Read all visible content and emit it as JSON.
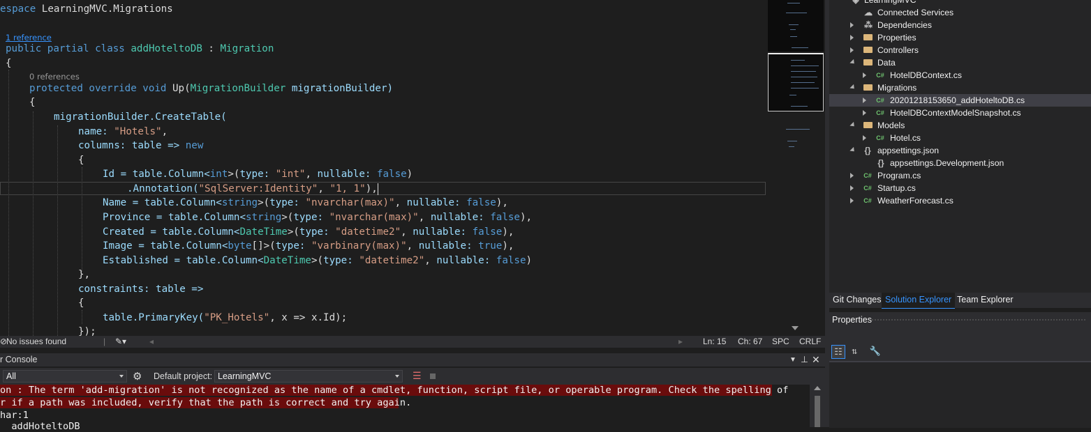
{
  "editor": {
    "codelens": {
      "class_refs": "1 reference",
      "method_refs": "0 references"
    },
    "lines": {
      "l0_pre": "espace ",
      "l0_ns": "LearningMVC.Migrations",
      "l1_kw": "public partial class ",
      "l1_name": "addHoteltoDB",
      "l1_sep": " : ",
      "l1_base": "Migration",
      "l2": "{",
      "l3_kw": "protected override void ",
      "l3_name": "Up(",
      "l3_type": "MigrationBuilder",
      "l3_param": " migrationBuilder)",
      "l4": "{",
      "l5": "migrationBuilder.CreateTable(",
      "l6_a": "name: ",
      "l6_b": "\"Hotels\"",
      "l6_c": ",",
      "l7_a": "columns: ",
      "l7_b": "table => ",
      "l7_c": "new",
      "l8": "{",
      "l9_a": "Id = table.Column<",
      "l9_b": "int",
      "l9_c": ">(",
      "l9_d": "type: ",
      "l9_e": "\"int\"",
      "l9_f": ", ",
      "l9_g": "nullable: ",
      "l9_h": "false",
      "l9_i": ")",
      "l10_a": ".Annotation(",
      "l10_b": "\"SqlServer:Identity\"",
      "l10_c": ", ",
      "l10_d": "\"1, 1\"",
      "l10_e": "),",
      "l11_a": "Name = table.Column<",
      "l11_b": "string",
      "l11_c": ">(",
      "l11_d": "type: ",
      "l11_e": "\"nvarchar(max)\"",
      "l11_f": ", ",
      "l11_g": "nullable: ",
      "l11_h": "false",
      "l11_i": "),",
      "l12_a": "Province = table.Column<",
      "l12_b": "string",
      "l12_c": ">(",
      "l12_d": "type: ",
      "l12_e": "\"nvarchar(max)\"",
      "l12_f": ", ",
      "l12_g": "nullable: ",
      "l12_h": "false",
      "l12_i": "),",
      "l13_a": "Created = table.Column<",
      "l13_b": "DateTime",
      "l13_c": ">(",
      "l13_d": "type: ",
      "l13_e": "\"datetime2\"",
      "l13_f": ", ",
      "l13_g": "nullable: ",
      "l13_h": "false",
      "l13_i": "),",
      "l14_a": "Image = table.Column<",
      "l14_b": "byte",
      "l14_c": "[]>(",
      "l14_d": "type: ",
      "l14_e": "\"varbinary(max)\"",
      "l14_f": ", ",
      "l14_g": "nullable: ",
      "l14_h": "true",
      "l14_i": "),",
      "l15_a": "Established = table.Column<",
      "l15_b": "DateTime",
      "l15_c": ">(",
      "l15_d": "type: ",
      "l15_e": "\"datetime2\"",
      "l15_f": ", ",
      "l15_g": "nullable: ",
      "l15_h": "false",
      "l15_i": ")",
      "l16": "},",
      "l17_a": "constraints: ",
      "l17_b": "table =>",
      "l18": "{",
      "l19_a": "table.PrimaryKey(",
      "l19_b": "\"PK_Hotels\"",
      "l19_c": ", x => x.Id);",
      "l20": "});"
    }
  },
  "statusbar": {
    "issues": "No issues found",
    "line": "Ln: 15",
    "col": "Ch: 67",
    "whitespace": "SPC",
    "eol": "CRLF"
  },
  "console": {
    "title": "r Console",
    "source": "All",
    "default_project_label": "Default project:",
    "default_project": "LearningMVC",
    "error_line1": "on : The term 'add-migration' is not recognized as the name of a cmdlet, function, script file, or operable program. Check the spelling of",
    "error_line2": "r if a path was included, verify that the path is correct and try again.",
    "out_line3": "har:1",
    "out_line4": "  addHoteltoDB"
  },
  "solution_explorer": {
    "root": "LearningMVC",
    "items": [
      {
        "label": "Connected Services",
        "icon": "cloud-icon"
      },
      {
        "label": "Dependencies",
        "icon": "dependencies-icon"
      },
      {
        "label": "Properties",
        "icon": "wrench-folder-icon"
      },
      {
        "label": "Controllers",
        "icon": "folder-icon"
      },
      {
        "label": "Data",
        "icon": "folder-icon"
      },
      {
        "label": "HotelDBContext.cs",
        "icon": "csharp-file-icon"
      },
      {
        "label": "Migrations",
        "icon": "folder-icon"
      },
      {
        "label": "20201218153650_addHoteltoDB.cs",
        "icon": "csharp-file-icon"
      },
      {
        "label": "HotelDBContextModelSnapshot.cs",
        "icon": "csharp-file-icon"
      },
      {
        "label": "Models",
        "icon": "folder-icon"
      },
      {
        "label": "Hotel.cs",
        "icon": "csharp-file-icon"
      },
      {
        "label": "appsettings.json",
        "icon": "json-file-icon"
      },
      {
        "label": "appsettings.Development.json",
        "icon": "json-file-icon"
      },
      {
        "label": "Program.cs",
        "icon": "csharp-file-icon"
      },
      {
        "label": "Startup.cs",
        "icon": "csharp-file-icon"
      },
      {
        "label": "WeatherForecast.cs",
        "icon": "csharp-file-icon"
      }
    ],
    "selected": "20201218153650_addHoteltoDB.cs"
  },
  "tabs": {
    "git": "Git Changes",
    "solution": "Solution Explorer",
    "team": "Team Explorer"
  },
  "properties": {
    "title": "Properties"
  },
  "colors": {
    "keyword": "#569cd6",
    "type": "#4ec9b0",
    "string": "#d69d85",
    "accent": "#3794ff",
    "error_bg": "#6a0c0c"
  }
}
